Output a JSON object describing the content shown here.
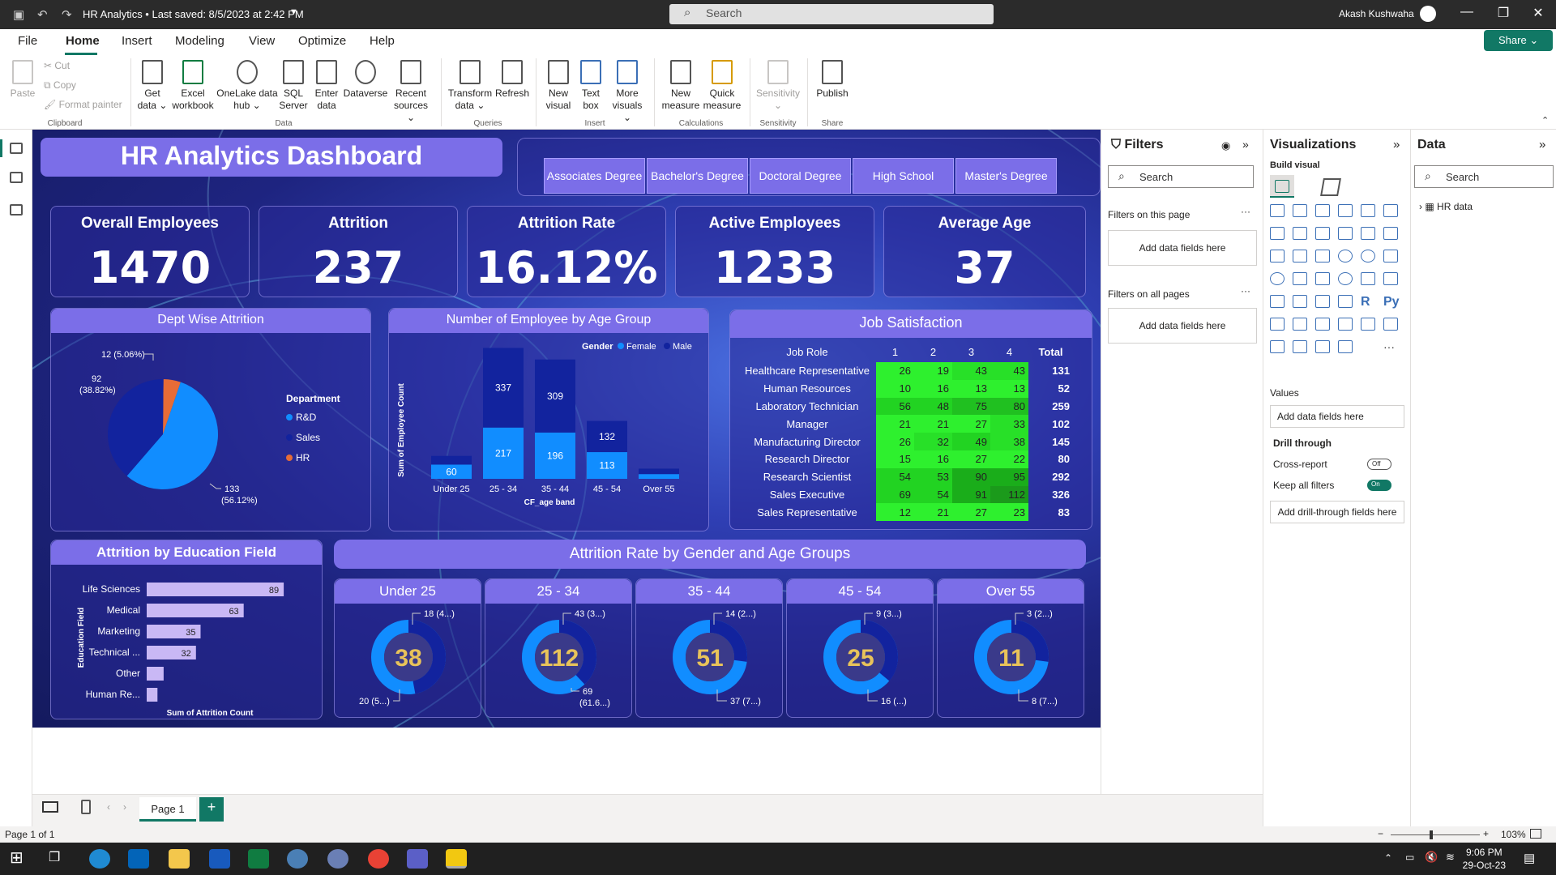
{
  "titlebar": {
    "title": "HR Analytics • Last saved: 8/5/2023 at 2:42 PM",
    "search_placeholder": "Search",
    "user": "Akash Kushwaha"
  },
  "menu": {
    "items": [
      "File",
      "Home",
      "Insert",
      "Modeling",
      "View",
      "Optimize",
      "Help"
    ],
    "share": "Share"
  },
  "ribbon": {
    "clipboard": {
      "paste": "Paste",
      "cut": "Cut",
      "copy": "Copy",
      "format_painter": "Format painter",
      "group": "Clipboard"
    },
    "data": [
      {
        "label": "Get data ⌄"
      },
      {
        "label": "Excel workbook"
      },
      {
        "label": "OneLake data hub ⌄"
      },
      {
        "label": "SQL Server"
      },
      {
        "label": "Enter data"
      },
      {
        "label": "Dataverse"
      },
      {
        "label": "Recent sources ⌄"
      }
    ],
    "data_group": "Data",
    "queries": [
      {
        "label": "Transform data ⌄"
      },
      {
        "label": "Refresh"
      }
    ],
    "queries_group": "Queries",
    "insert": [
      {
        "label": "New visual"
      },
      {
        "label": "Text box"
      },
      {
        "label": "More visuals ⌄"
      }
    ],
    "insert_group": "Insert",
    "calculations": [
      {
        "label": "New measure"
      },
      {
        "label": "Quick measure"
      }
    ],
    "calculations_group": "Calculations",
    "sensitivity": {
      "label": "Sensitivity ⌄",
      "group": "Sensitivity"
    },
    "share": {
      "label": "Publish",
      "group": "Share"
    }
  },
  "dashboard": {
    "title": "HR Analytics Dashboard",
    "education_slicer": [
      "Associates Degree",
      "Bachelor's Degree",
      "Doctoral Degree",
      "High School",
      "Master's Degree"
    ],
    "kpis": [
      {
        "label": "Overall Employees",
        "value": "1470"
      },
      {
        "label": "Attrition",
        "value": "237"
      },
      {
        "label": "Attrition Rate",
        "value": "16.12%"
      },
      {
        "label": "Active Employees",
        "value": "1233"
      },
      {
        "label": "Average Age",
        "value": "37"
      }
    ],
    "dept_attrition": {
      "title": "Dept Wise Attrition",
      "legend_title": "Department",
      "labels": [
        "12 (5.06%)",
        "92 (38.82%)",
        "133 (56.12%)"
      ]
    },
    "age_group": {
      "title": "Number of Employee by Age Group",
      "legend_title": "Gender",
      "ylabel": "Sum of Employee Count",
      "xlabel": "CF_age band"
    },
    "job_satisfaction": {
      "title": "Job Satisfaction",
      "headers": [
        "Job Role",
        "1",
        "2",
        "3",
        "4",
        "Total"
      ]
    },
    "education_field": {
      "title": "Attrition by Education Field",
      "ylabel": "Education Field",
      "xlabel": "Sum of Attrition Count"
    },
    "gender_age": {
      "title": "Attrition Rate by Gender and Age Groups",
      "groups": [
        {
          "band": "Under 25",
          "total": "38",
          "top_label": "18 (4...)",
          "bottom_label": "20 (5...)",
          "male_share": 0.47
        },
        {
          "band": "25 - 34",
          "total": "112",
          "top_label": "43 (3...)",
          "bottom_label": "69 (61.6...)",
          "male_share": 0.38
        },
        {
          "band": "35 - 44",
          "total": "51",
          "top_label": "14 (2...)",
          "bottom_label": "37 (7...)",
          "male_share": 0.27
        },
        {
          "band": "45 - 54",
          "total": "25",
          "top_label": "9 (3...)",
          "bottom_label": "16 (...)",
          "male_share": 0.36
        },
        {
          "band": "Over 55",
          "total": "11",
          "top_label": "3 (2...)",
          "bottom_label": "8 (7...)",
          "male_share": 0.27
        }
      ]
    }
  },
  "chart_data": [
    {
      "type": "pie",
      "title": "Dept Wise Attrition",
      "legend_title": "Department",
      "categories": [
        "R&D",
        "Sales",
        "HR"
      ],
      "values": [
        133,
        92,
        12
      ],
      "colors": [
        "#118dff",
        "#12239e",
        "#e66c37"
      ]
    },
    {
      "type": "bar",
      "title": "Number of Employee by Age Group",
      "stacked": true,
      "categories": [
        "Under 25",
        "25 - 34",
        "35 - 44",
        "45 - 54",
        "Over 55"
      ],
      "series": [
        {
          "name": "Female",
          "values": [
            60,
            217,
            196,
            113,
            20
          ],
          "color": "#118dff"
        },
        {
          "name": "Male",
          "values": [
            37,
            337,
            309,
            132,
            23
          ],
          "color": "#12239e"
        }
      ],
      "data_labels": [
        [
          "60",
          "217",
          "196",
          "113",
          ""
        ],
        [
          "",
          "337",
          "309",
          "132",
          ""
        ]
      ],
      "xlabel": "CF_age band",
      "ylabel": "Sum of Employee Count",
      "ylim": [
        0,
        600
      ]
    },
    {
      "type": "table",
      "title": "Job Satisfaction",
      "columns": [
        "Job Role",
        "1",
        "2",
        "3",
        "4",
        "Total"
      ],
      "rows": [
        [
          "Healthcare Representative",
          26,
          19,
          43,
          43,
          131
        ],
        [
          "Human Resources",
          10,
          16,
          13,
          13,
          52
        ],
        [
          "Laboratory Technician",
          56,
          48,
          75,
          80,
          259
        ],
        [
          "Manager",
          21,
          21,
          27,
          33,
          102
        ],
        [
          "Manufacturing Director",
          26,
          32,
          49,
          38,
          145
        ],
        [
          "Research Director",
          15,
          16,
          27,
          22,
          80
        ],
        [
          "Research Scientist",
          54,
          53,
          90,
          95,
          292
        ],
        [
          "Sales Executive",
          69,
          54,
          91,
          112,
          326
        ],
        [
          "Sales Representative",
          12,
          21,
          27,
          23,
          83
        ]
      ]
    },
    {
      "type": "bar",
      "orientation": "horizontal",
      "title": "Attrition by Education Field",
      "categories": [
        "Life Sciences",
        "Medical",
        "Marketing",
        "Technical ...",
        "Other",
        "Human Re..."
      ],
      "values": [
        89,
        63,
        35,
        32,
        11,
        7
      ],
      "data_labels": [
        "89",
        "63",
        "35",
        "32",
        "",
        ""
      ],
      "xlabel": "Sum of Attrition Count",
      "ylabel": "Education Field",
      "xlim": [
        0,
        100
      ]
    }
  ],
  "filters": {
    "title": "Filters",
    "search": "Search",
    "on_page": "Filters on this page",
    "all_pages": "Filters on all pages",
    "add": "Add data fields here"
  },
  "visualizations": {
    "title": "Visualizations",
    "build": "Build visual",
    "values": "Values",
    "add_values": "Add data fields here",
    "drill": "Drill through",
    "cross": "Cross-report",
    "cross_state": "Off",
    "keep": "Keep all filters",
    "keep_state": "On",
    "add_drill": "Add drill-through fields here",
    "r_label": "R",
    "py_label": "Py",
    "more": "···"
  },
  "data_pane": {
    "title": "Data",
    "search": "Search",
    "table": "HR data"
  },
  "pages": {
    "tab": "Page 1",
    "status": "Page 1 of 1",
    "zoom": "103%"
  },
  "taskbar": {
    "time": "9:06 PM",
    "date": "29-Oct-23"
  },
  "colors": {
    "accent": "#117865",
    "card_header": "#7b6ee8",
    "female": "#118dff",
    "male": "#12239e",
    "hr": "#e66c37"
  }
}
